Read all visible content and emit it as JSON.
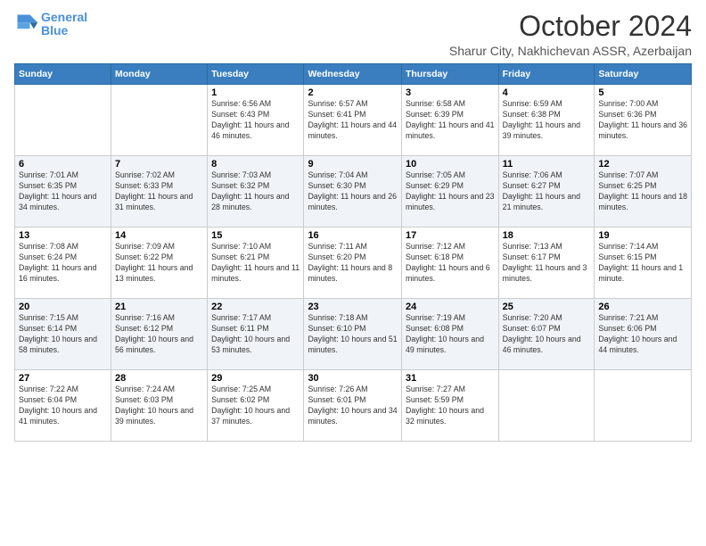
{
  "header": {
    "logo_line1": "General",
    "logo_line2": "Blue",
    "month": "October 2024",
    "location": "Sharur City, Nakhichevan ASSR, Azerbaijan"
  },
  "days_of_week": [
    "Sunday",
    "Monday",
    "Tuesday",
    "Wednesday",
    "Thursday",
    "Friday",
    "Saturday"
  ],
  "weeks": [
    [
      {
        "day": "",
        "sunrise": "",
        "sunset": "",
        "daylight": ""
      },
      {
        "day": "",
        "sunrise": "",
        "sunset": "",
        "daylight": ""
      },
      {
        "day": "1",
        "sunrise": "Sunrise: 6:56 AM",
        "sunset": "Sunset: 6:43 PM",
        "daylight": "Daylight: 11 hours and 46 minutes."
      },
      {
        "day": "2",
        "sunrise": "Sunrise: 6:57 AM",
        "sunset": "Sunset: 6:41 PM",
        "daylight": "Daylight: 11 hours and 44 minutes."
      },
      {
        "day": "3",
        "sunrise": "Sunrise: 6:58 AM",
        "sunset": "Sunset: 6:39 PM",
        "daylight": "Daylight: 11 hours and 41 minutes."
      },
      {
        "day": "4",
        "sunrise": "Sunrise: 6:59 AM",
        "sunset": "Sunset: 6:38 PM",
        "daylight": "Daylight: 11 hours and 39 minutes."
      },
      {
        "day": "5",
        "sunrise": "Sunrise: 7:00 AM",
        "sunset": "Sunset: 6:36 PM",
        "daylight": "Daylight: 11 hours and 36 minutes."
      }
    ],
    [
      {
        "day": "6",
        "sunrise": "Sunrise: 7:01 AM",
        "sunset": "Sunset: 6:35 PM",
        "daylight": "Daylight: 11 hours and 34 minutes."
      },
      {
        "day": "7",
        "sunrise": "Sunrise: 7:02 AM",
        "sunset": "Sunset: 6:33 PM",
        "daylight": "Daylight: 11 hours and 31 minutes."
      },
      {
        "day": "8",
        "sunrise": "Sunrise: 7:03 AM",
        "sunset": "Sunset: 6:32 PM",
        "daylight": "Daylight: 11 hours and 28 minutes."
      },
      {
        "day": "9",
        "sunrise": "Sunrise: 7:04 AM",
        "sunset": "Sunset: 6:30 PM",
        "daylight": "Daylight: 11 hours and 26 minutes."
      },
      {
        "day": "10",
        "sunrise": "Sunrise: 7:05 AM",
        "sunset": "Sunset: 6:29 PM",
        "daylight": "Daylight: 11 hours and 23 minutes."
      },
      {
        "day": "11",
        "sunrise": "Sunrise: 7:06 AM",
        "sunset": "Sunset: 6:27 PM",
        "daylight": "Daylight: 11 hours and 21 minutes."
      },
      {
        "day": "12",
        "sunrise": "Sunrise: 7:07 AM",
        "sunset": "Sunset: 6:25 PM",
        "daylight": "Daylight: 11 hours and 18 minutes."
      }
    ],
    [
      {
        "day": "13",
        "sunrise": "Sunrise: 7:08 AM",
        "sunset": "Sunset: 6:24 PM",
        "daylight": "Daylight: 11 hours and 16 minutes."
      },
      {
        "day": "14",
        "sunrise": "Sunrise: 7:09 AM",
        "sunset": "Sunset: 6:22 PM",
        "daylight": "Daylight: 11 hours and 13 minutes."
      },
      {
        "day": "15",
        "sunrise": "Sunrise: 7:10 AM",
        "sunset": "Sunset: 6:21 PM",
        "daylight": "Daylight: 11 hours and 11 minutes."
      },
      {
        "day": "16",
        "sunrise": "Sunrise: 7:11 AM",
        "sunset": "Sunset: 6:20 PM",
        "daylight": "Daylight: 11 hours and 8 minutes."
      },
      {
        "day": "17",
        "sunrise": "Sunrise: 7:12 AM",
        "sunset": "Sunset: 6:18 PM",
        "daylight": "Daylight: 11 hours and 6 minutes."
      },
      {
        "day": "18",
        "sunrise": "Sunrise: 7:13 AM",
        "sunset": "Sunset: 6:17 PM",
        "daylight": "Daylight: 11 hours and 3 minutes."
      },
      {
        "day": "19",
        "sunrise": "Sunrise: 7:14 AM",
        "sunset": "Sunset: 6:15 PM",
        "daylight": "Daylight: 11 hours and 1 minute."
      }
    ],
    [
      {
        "day": "20",
        "sunrise": "Sunrise: 7:15 AM",
        "sunset": "Sunset: 6:14 PM",
        "daylight": "Daylight: 10 hours and 58 minutes."
      },
      {
        "day": "21",
        "sunrise": "Sunrise: 7:16 AM",
        "sunset": "Sunset: 6:12 PM",
        "daylight": "Daylight: 10 hours and 56 minutes."
      },
      {
        "day": "22",
        "sunrise": "Sunrise: 7:17 AM",
        "sunset": "Sunset: 6:11 PM",
        "daylight": "Daylight: 10 hours and 53 minutes."
      },
      {
        "day": "23",
        "sunrise": "Sunrise: 7:18 AM",
        "sunset": "Sunset: 6:10 PM",
        "daylight": "Daylight: 10 hours and 51 minutes."
      },
      {
        "day": "24",
        "sunrise": "Sunrise: 7:19 AM",
        "sunset": "Sunset: 6:08 PM",
        "daylight": "Daylight: 10 hours and 49 minutes."
      },
      {
        "day": "25",
        "sunrise": "Sunrise: 7:20 AM",
        "sunset": "Sunset: 6:07 PM",
        "daylight": "Daylight: 10 hours and 46 minutes."
      },
      {
        "day": "26",
        "sunrise": "Sunrise: 7:21 AM",
        "sunset": "Sunset: 6:06 PM",
        "daylight": "Daylight: 10 hours and 44 minutes."
      }
    ],
    [
      {
        "day": "27",
        "sunrise": "Sunrise: 7:22 AM",
        "sunset": "Sunset: 6:04 PM",
        "daylight": "Daylight: 10 hours and 41 minutes."
      },
      {
        "day": "28",
        "sunrise": "Sunrise: 7:24 AM",
        "sunset": "Sunset: 6:03 PM",
        "daylight": "Daylight: 10 hours and 39 minutes."
      },
      {
        "day": "29",
        "sunrise": "Sunrise: 7:25 AM",
        "sunset": "Sunset: 6:02 PM",
        "daylight": "Daylight: 10 hours and 37 minutes."
      },
      {
        "day": "30",
        "sunrise": "Sunrise: 7:26 AM",
        "sunset": "Sunset: 6:01 PM",
        "daylight": "Daylight: 10 hours and 34 minutes."
      },
      {
        "day": "31",
        "sunrise": "Sunrise: 7:27 AM",
        "sunset": "Sunset: 5:59 PM",
        "daylight": "Daylight: 10 hours and 32 minutes."
      },
      {
        "day": "",
        "sunrise": "",
        "sunset": "",
        "daylight": ""
      },
      {
        "day": "",
        "sunrise": "",
        "sunset": "",
        "daylight": ""
      }
    ]
  ]
}
